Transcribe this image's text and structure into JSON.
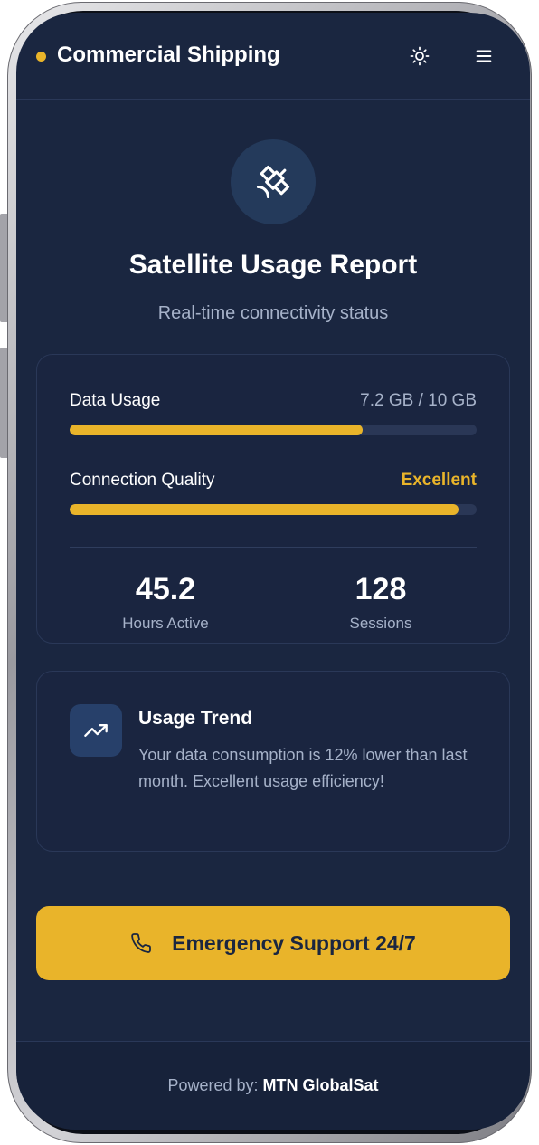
{
  "header": {
    "title": "Commercial Shipping",
    "accent_color": "#e9b42a",
    "theme_icon": "sun-icon",
    "menu_icon": "hamburger-menu-icon"
  },
  "hero": {
    "icon": "satellite-icon",
    "title": "Satellite Usage Report",
    "subtitle": "Real-time connectivity status"
  },
  "stats_card": {
    "data_usage": {
      "label": "Data Usage",
      "value": "7.2 GB / 10 GB",
      "progress": 0.72
    },
    "connection_quality": {
      "label": "Connection Quality",
      "value": "Excellent",
      "value_color": "#e9b42a",
      "progress": 0.955
    },
    "hours_active": {
      "value": "45.2",
      "label": "Hours Active"
    },
    "sessions": {
      "value": "128",
      "label": "Sessions"
    }
  },
  "trend_card": {
    "icon": "trending-up-icon",
    "title": "Usage Trend",
    "body": "Your data consumption is 12% lower than last month. Excellent usage efficiency!"
  },
  "cta": {
    "icon": "phone-icon",
    "label": "Emergency Support 24/7"
  },
  "footer": {
    "prefix": "Powered by:",
    "brand": "MTN GlobalSat"
  },
  "colors": {
    "background": "#1a2640",
    "card_border": "#2a3858",
    "muted_text": "#a6b2c9",
    "bar_track": "#2a3756"
  }
}
